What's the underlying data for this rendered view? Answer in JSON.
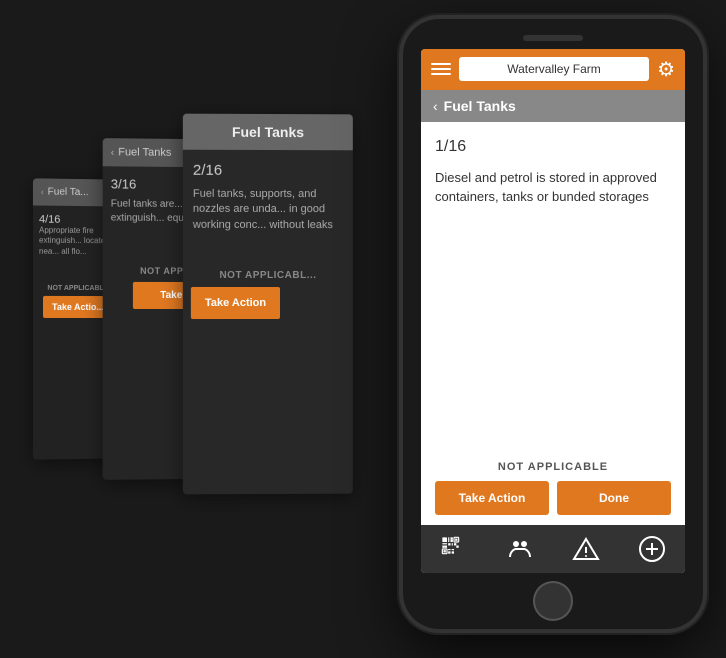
{
  "phone": {
    "header": {
      "menu_icon": "☰",
      "location": "Watervalley Farm",
      "settings_icon": "⚙"
    },
    "subheader": {
      "back_label": "‹",
      "title": "Fuel Tanks"
    },
    "content": {
      "count": "1/16",
      "question": "Diesel and petrol is stored in approved containers, tanks or bunded storages"
    },
    "action": {
      "not_applicable_label": "NOT APPLICABLE",
      "take_action_label": "Take Action",
      "done_label": "Done"
    },
    "nav": {
      "qr_icon": "qr-code",
      "people_icon": "people",
      "warning_icon": "warning",
      "plus_icon": "plus"
    }
  },
  "cards": [
    {
      "id": "card-1",
      "header": "Fuel Ta...",
      "count": "4/16",
      "desc": "Appropriate fire extinguish... located nea... all flo...",
      "not_applicable": "NOT APPLICABLE",
      "take_action": "Take Actio..."
    },
    {
      "id": "card-2",
      "header": "Fuel Tanks",
      "count": "3/16",
      "desc": "Fuel tanks are... fire extinguish... equip... bottom-...",
      "not_applicable": "NOT APPLICABLE",
      "take_action": "Take Ac..."
    },
    {
      "id": "card-3",
      "header": "Fuel Tanks",
      "count": "2/16",
      "desc": "Fuel tanks, supports, and nozzles are unda... in good working conc... without leaks",
      "not_applicable": "NOT APPLICABL...",
      "take_action": "Take Action"
    }
  ]
}
